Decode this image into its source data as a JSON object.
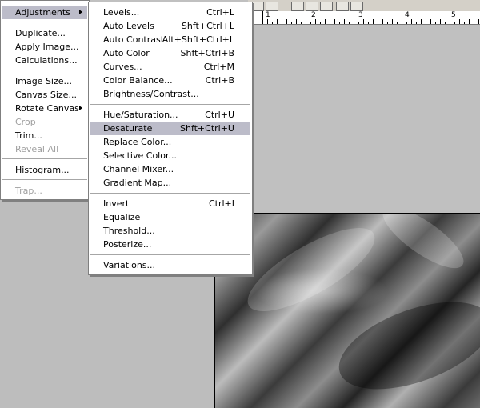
{
  "main_menu": {
    "items": [
      {
        "label": "Adjustments",
        "enabled": true,
        "submenu": true
      },
      {
        "label": "Duplicate...",
        "enabled": true
      },
      {
        "label": "Apply Image...",
        "enabled": true
      },
      {
        "label": "Calculations...",
        "enabled": true
      },
      {
        "label": "Image Size...",
        "enabled": true
      },
      {
        "label": "Canvas Size...",
        "enabled": true
      },
      {
        "label": "Rotate Canvas",
        "enabled": true,
        "submenu": true
      },
      {
        "label": "Crop",
        "enabled": false
      },
      {
        "label": "Trim...",
        "enabled": true
      },
      {
        "label": "Reveal All",
        "enabled": false
      },
      {
        "label": "Histogram...",
        "enabled": true
      },
      {
        "label": "Trap...",
        "enabled": false
      }
    ]
  },
  "adjustments_menu": {
    "items": [
      {
        "label": "Levels...",
        "shortcut": "Ctrl+L"
      },
      {
        "label": "Auto Levels",
        "shortcut": "Shft+Ctrl+L"
      },
      {
        "label": "Auto Contrast",
        "shortcut": "Alt+Shft+Ctrl+L"
      },
      {
        "label": "Auto Color",
        "shortcut": "Shft+Ctrl+B"
      },
      {
        "label": "Curves...",
        "shortcut": "Ctrl+M"
      },
      {
        "label": "Color Balance...",
        "shortcut": "Ctrl+B"
      },
      {
        "label": "Brightness/Contrast...",
        "shortcut": ""
      },
      {
        "label": "Hue/Saturation...",
        "shortcut": "Ctrl+U"
      },
      {
        "label": "Desaturate",
        "shortcut": "Shft+Ctrl+U",
        "highlighted": true
      },
      {
        "label": "Replace Color...",
        "shortcut": ""
      },
      {
        "label": "Selective Color...",
        "shortcut": ""
      },
      {
        "label": "Channel Mixer...",
        "shortcut": ""
      },
      {
        "label": "Gradient Map...",
        "shortcut": ""
      },
      {
        "label": "Invert",
        "shortcut": "Ctrl+I"
      },
      {
        "label": "Equalize",
        "shortcut": ""
      },
      {
        "label": "Threshold...",
        "shortcut": ""
      },
      {
        "label": "Posterize...",
        "shortcut": ""
      },
      {
        "label": "Variations...",
        "shortcut": ""
      }
    ]
  },
  "ruler": {
    "labels": [
      "1",
      "2",
      "3",
      "4",
      "5"
    ]
  },
  "colors": {
    "highlight": "#bcbcc9",
    "menu_bg": "#ffffff",
    "workspace": "#c0c0c0",
    "disabled_text": "#a0a0a0"
  }
}
